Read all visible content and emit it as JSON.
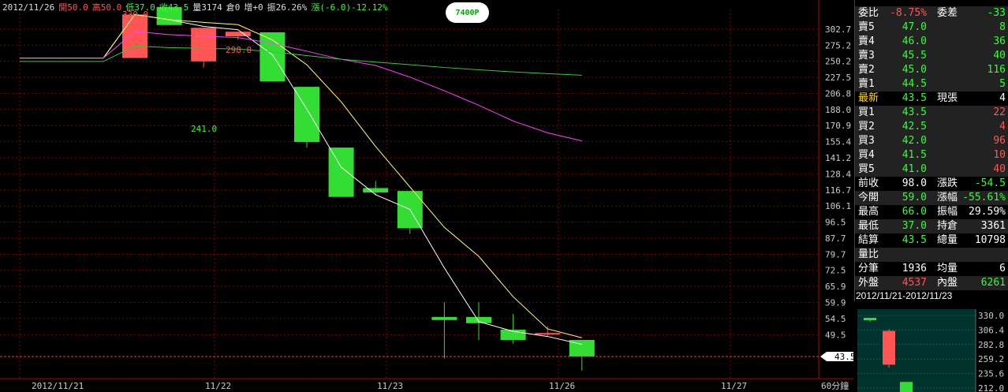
{
  "header": {
    "date": "2012/11/26",
    "open_label": "開50.0",
    "high_label": "高50.0",
    "low_label": "低37.0",
    "close_label": "收43.5",
    "volume_label": "量3174",
    "oi_label": "倉0",
    "incr_label": "增+0",
    "amp_label": "振26.26%",
    "chg_label": "漲(-6.0)-12.12%"
  },
  "badge_text": "7400P",
  "price_axis": [
    "302.7",
    "275.2",
    "250.2",
    "227.5",
    "206.8",
    "188.0",
    "170.9",
    "155.4",
    "141.2",
    "128.4",
    "116.7",
    "106.1",
    "96.5",
    "87.7",
    "79.7",
    "72.5",
    "65.9",
    "59.9",
    "54.5",
    "49.5"
  ],
  "current_price_tag": "43.5",
  "x_axis": [
    "2012/11/21",
    "11/22",
    "11/23",
    "11/26",
    "11/27"
  ],
  "period_label": "60分鐘",
  "annotations": {
    "high1": "330.0",
    "high2": "298.0",
    "low1": "241.0"
  },
  "chart_data": {
    "type": "candlestick",
    "scale": "log",
    "ylim": [
      40,
      340
    ],
    "candles": [
      {
        "o": 255,
        "h": 330,
        "l": 255,
        "c": 330
      },
      {
        "o": 345,
        "h": 345,
        "l": 310,
        "c": 310
      },
      {
        "o": 250,
        "h": 305,
        "l": 241,
        "c": 305
      },
      {
        "o": 290,
        "h": 298,
        "l": 284,
        "c": 298
      },
      {
        "o": 297,
        "h": 297,
        "l": 222,
        "c": 222
      },
      {
        "o": 215,
        "h": 215,
        "l": 150,
        "c": 155
      },
      {
        "o": 150,
        "h": 150,
        "l": 112,
        "c": 112
      },
      {
        "o": 118,
        "h": 123,
        "l": 113,
        "c": 115
      },
      {
        "o": 116,
        "h": 116,
        "l": 90,
        "c": 93
      },
      {
        "o": 55,
        "h": 60,
        "l": 43,
        "c": 54
      },
      {
        "o": 55,
        "h": 60,
        "l": 48,
        "c": 53
      },
      {
        "o": 51,
        "h": 56,
        "l": 47,
        "c": 48
      },
      {
        "o": 50,
        "h": 52,
        "l": 49,
        "c": 50
      },
      {
        "o": 48,
        "h": 48,
        "l": 40,
        "c": 43.5
      }
    ],
    "ma_colors": [
      "#ffffff",
      "#ffff66",
      "#ff44ff",
      "#33cc33"
    ]
  },
  "quote": {
    "rows": [
      {
        "l1": "委比",
        "v1": "-8.75%",
        "l2": "委差",
        "v2": "-33",
        "c1": "#ff5555",
        "c2": "#33ff33",
        "hl": true
      },
      {
        "l1": "賣5",
        "v1": "47.0",
        "l2": "",
        "v2": "8",
        "c1": "#33ff33",
        "c2": "#33ff33",
        "hl": true
      },
      {
        "l1": "賣4",
        "v1": "46.0",
        "l2": "",
        "v2": "36",
        "c1": "#33ff33",
        "c2": "#33ff33",
        "hl": true
      },
      {
        "l1": "賣3",
        "v1": "45.5",
        "l2": "",
        "v2": "40",
        "c1": "#33ff33",
        "c2": "#33ff33",
        "hl": true
      },
      {
        "l1": "賣2",
        "v1": "45.0",
        "l2": "",
        "v2": "116",
        "c1": "#33ff33",
        "c2": "#33ff33",
        "hl": true
      },
      {
        "l1": "賣1",
        "v1": "44.5",
        "l2": "",
        "v2": "5",
        "c1": "#33ff33",
        "c2": "#33ff33",
        "hl": true
      },
      {
        "l1": "最新",
        "v1": "43.5",
        "l2": "現張",
        "v2": "4",
        "c1": "#33ff33",
        "c2": "#fff",
        "hl": false,
        "yellow": true
      },
      {
        "l1": "買1",
        "v1": "43.5",
        "l2": "",
        "v2": "22",
        "c1": "#33ff33",
        "c2": "#ff5555",
        "hl": true
      },
      {
        "l1": "買2",
        "v1": "42.5",
        "l2": "",
        "v2": "4",
        "c1": "#33ff33",
        "c2": "#ff5555",
        "hl": true
      },
      {
        "l1": "買3",
        "v1": "42.0",
        "l2": "",
        "v2": "96",
        "c1": "#33ff33",
        "c2": "#ff5555",
        "hl": true
      },
      {
        "l1": "買4",
        "v1": "41.5",
        "l2": "",
        "v2": "10",
        "c1": "#33ff33",
        "c2": "#ff5555",
        "hl": true
      },
      {
        "l1": "買5",
        "v1": "41.0",
        "l2": "",
        "v2": "40",
        "c1": "#33ff33",
        "c2": "#ff5555",
        "hl": true
      },
      {
        "l1": "前收",
        "v1": "98.0",
        "l2": "漲跌",
        "v2": "-54.5",
        "c1": "#fff",
        "c2": "#33ff33",
        "hl": false
      },
      {
        "l1": "今開",
        "v1": "59.0",
        "l2": "漲幅",
        "v2": "-55.61%",
        "c1": "#33ff33",
        "c2": "#33ff33",
        "hl": true
      },
      {
        "l1": "最高",
        "v1": "66.0",
        "l2": "振幅",
        "v2": "29.59%",
        "c1": "#33ff33",
        "c2": "#fff",
        "hl": false
      },
      {
        "l1": "最低",
        "v1": "37.0",
        "l2": "持倉",
        "v2": "3361",
        "c1": "#33ff33",
        "c2": "#fff",
        "hl": true
      },
      {
        "l1": "結算",
        "v1": "43.5",
        "l2": "總量",
        "v2": "10798",
        "c1": "#33ff33",
        "c2": "#fff",
        "hl": false
      },
      {
        "l1": "量比",
        "v1": "",
        "l2": "",
        "v2": "",
        "c1": "#fff",
        "c2": "#fff",
        "hl": true
      },
      {
        "l1": "分筆",
        "v1": "1936",
        "l2": "均量",
        "v2": "6",
        "c1": "#fff",
        "c2": "#fff",
        "hl": false
      },
      {
        "l1": "外盤",
        "v1": "4537",
        "l2": "內盤",
        "v2": "6261",
        "c1": "#ff5555",
        "c2": "#33ff33",
        "hl": true
      }
    ]
  },
  "mini_chart": {
    "title": "2012/11/21-2012/11/23",
    "axis": [
      "330.0",
      "306.4",
      "282.8",
      "259.2",
      "235.6",
      "212.0"
    ]
  }
}
